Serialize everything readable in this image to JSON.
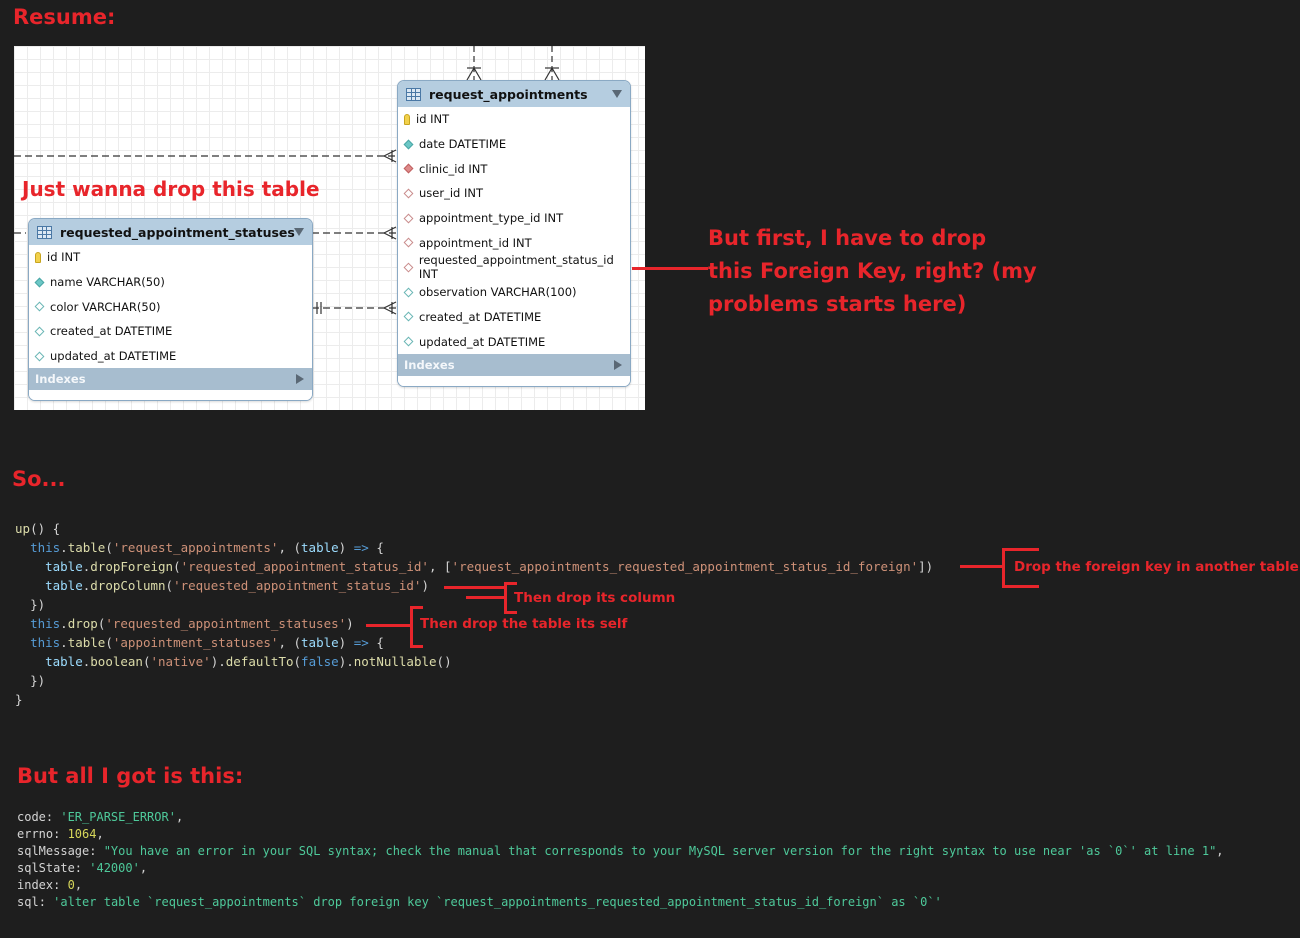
{
  "headings": {
    "resume": "Resume:",
    "so": "So...",
    "but": "But all I got is this:"
  },
  "diagram": {
    "note_drop_table": "Just wanna drop this table",
    "note_fk": "But first, I have to drop this Foreign Key, right? (my problems starts here)",
    "table_right": {
      "name": "request_appointments",
      "columns": [
        {
          "label": "id INT",
          "marker": "key"
        },
        {
          "label": "date DATETIME",
          "marker": "teal"
        },
        {
          "label": "clinic_id INT",
          "marker": "red"
        },
        {
          "label": "user_id INT",
          "marker": "pink-outline"
        },
        {
          "label": "appointment_type_id INT",
          "marker": "pink-outline"
        },
        {
          "label": "appointment_id INT",
          "marker": "pink-outline"
        },
        {
          "label": "requested_appointment_status_id INT",
          "marker": "pink-outline"
        },
        {
          "label": "observation VARCHAR(100)",
          "marker": "teal-outline"
        },
        {
          "label": "created_at DATETIME",
          "marker": "teal-outline"
        },
        {
          "label": "updated_at DATETIME",
          "marker": "teal-outline"
        }
      ],
      "indexes": "Indexes"
    },
    "table_left": {
      "name": "requested_appointment_statuses",
      "columns": [
        {
          "label": "id INT",
          "marker": "key"
        },
        {
          "label": "name VARCHAR(50)",
          "marker": "teal"
        },
        {
          "label": "color VARCHAR(50)",
          "marker": "teal-outline"
        },
        {
          "label": "created_at DATETIME",
          "marker": "teal-outline"
        },
        {
          "label": "updated_at DATETIME",
          "marker": "teal-outline"
        }
      ],
      "indexes": "Indexes"
    }
  },
  "code": {
    "l1_a": "up",
    "l1_b": "() {",
    "l2_this": "this",
    "l2_table": "table",
    "l2_str": "'request_appointments'",
    "l2_param": "table",
    "l3_obj": "table",
    "l3_fn": "dropForeign",
    "l3_s1": "'requested_appointment_status_id'",
    "l3_s2": "'request_appointments_requested_appointment_status_id_foreign'",
    "l4_obj": "table",
    "l4_fn": "dropColumn",
    "l4_s": "'requested_appointment_status_id'",
    "l5": "})",
    "l6_this": "this",
    "l6_fn": "drop",
    "l6_s": "'requested_appointment_statuses'",
    "l7_this": "this",
    "l7_table": "table",
    "l7_str": "'appointment_statuses'",
    "l7_param": "table",
    "l8_obj": "table",
    "l8_fn1": "boolean",
    "l8_s": "'native'",
    "l8_fn2": "defaultTo",
    "l8_false": "false",
    "l8_fn3": "notNullable",
    "l9": "})",
    "l10": "}"
  },
  "code_notes": {
    "drop_fk": "Drop the foreign key in another table",
    "drop_col": "Then drop its column",
    "drop_table": "Then drop the table its self"
  },
  "error": {
    "code_key": "code",
    "code_val": "'ER_PARSE_ERROR'",
    "errno_key": "errno",
    "errno_val": "1064",
    "msg_key": "sqlMessage",
    "msg_val": "\"You have an error in your SQL syntax; check the manual that corresponds to your MySQL server version for the right syntax to use near 'as `0`' at line 1\"",
    "state_key": "sqlState",
    "state_val": "'42000'",
    "index_key": "index",
    "index_val": "0",
    "sql_key": "sql",
    "sql_val": "'alter table `request_appointments` drop foreign key `request_appointments_requested_appointment_status_id_foreign` as `0`'"
  },
  "colors": {
    "background": "#1e1e1e",
    "annotation_red": "#e8252b",
    "table_header": "#b5cde0",
    "error_string_green": "#4ec99a",
    "number_yellow": "#d7d75a"
  }
}
